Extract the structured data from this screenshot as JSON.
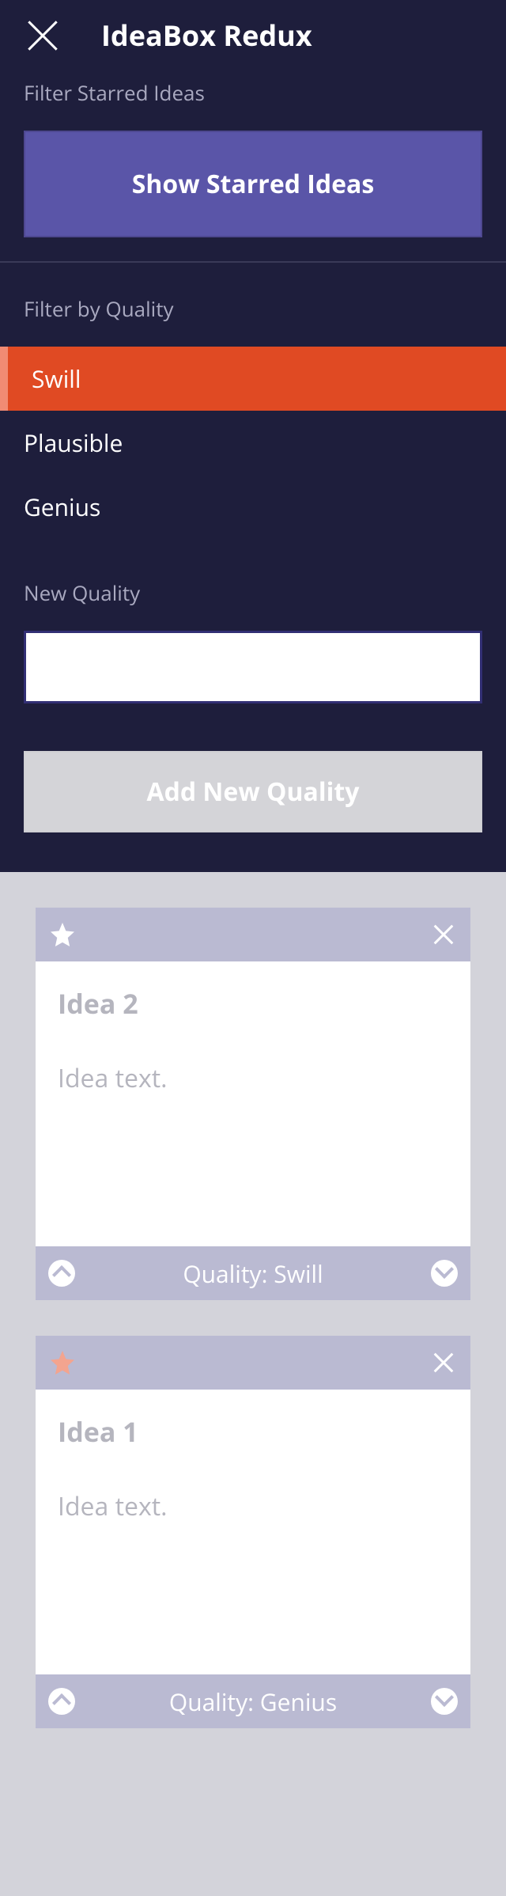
{
  "app": {
    "title": "IdeaBox Redux"
  },
  "filters": {
    "starredLabel": "Filter Starred Ideas",
    "showStarredButton": "Show Starred Ideas",
    "qualityLabel": "Filter by Quality",
    "qualities": [
      "Swill",
      "Plausible",
      "Genius"
    ],
    "activeQualityIndex": 0,
    "newQualityLabel": "New Quality",
    "addQualityButton": "Add New Quality"
  },
  "cards": [
    {
      "title": "Idea 2",
      "text": "Idea text.",
      "quality": "Swill",
      "starred": false
    },
    {
      "title": "Idea 1",
      "text": "Idea text.",
      "quality": "Genius",
      "starred": true
    }
  ],
  "strings": {
    "qualityPrefix": "Quality: "
  },
  "colors": {
    "starActive": "#f3a48f",
    "starInactive": "#ffffff"
  }
}
